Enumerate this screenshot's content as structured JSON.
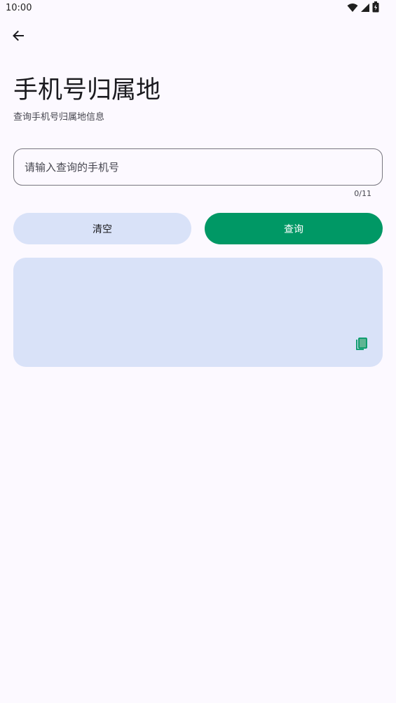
{
  "status_bar": {
    "time": "10:00",
    "icons": [
      "wifi-icon",
      "signal-icon",
      "battery-icon"
    ]
  },
  "nav": {
    "back_icon": "arrow-back-icon"
  },
  "header": {
    "title": "手机号归属地",
    "subtitle": "查询手机号归属地信息"
  },
  "phone_input": {
    "value": "",
    "placeholder": "请输入查询的手机号",
    "counter": "0/11"
  },
  "actions": {
    "clear_label": "清空",
    "query_label": "查询"
  },
  "result": {
    "text": "",
    "copy_icon": "copy-icon"
  },
  "colors": {
    "background": "#fcf9ff",
    "primary": "#009865",
    "secondary_container": "#d9e2f8",
    "outline": "#77767f"
  }
}
